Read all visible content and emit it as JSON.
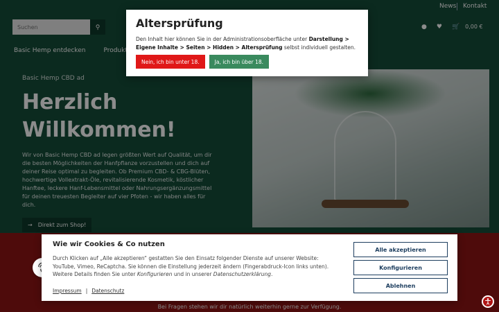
{
  "topbar": {
    "news": "News",
    "kontakt": "Kontakt"
  },
  "header": {
    "search_placeholder": "Suchen",
    "cart_total": "0,00 €"
  },
  "nav": {
    "items": [
      "Basic Hemp entdecken",
      "Produkte"
    ]
  },
  "hero": {
    "subtitle": "Basic Hemp CBD ad",
    "title_line1": "Herzlich",
    "title_line2": "Willkommen!",
    "text": "Wir von Basic Hemp CBD ad legen größten Wert auf Qualität, um dir die besten Möglichkeiten der Hanfpflanze vorzustellen und dich auf deiner Reise optimal zu begleiten. Ob Premium CBD- & CBG-Blüten, hochwertige Vollextrakt-Öle, revitalisierende Kosmetik, köstlicher Hanftee, leckere Hanf-Lebensmittel oder Nahrungsergänzungsmittel für deinen treuesten Begleiter auf vier Pfoten - wir haben alles für dich.",
    "button": "Direkt zum Shop!"
  },
  "band_text": "Bei Fragen stehen wir dir natürlich weiterhin gerne zur Verfügung.",
  "age_modal": {
    "title": "Altersprüfung",
    "text_prefix": "Den Inhalt hier können Sie in der Administrationsoberfläche unter ",
    "text_bold": "Darstellung > Eigene Inhalte > Seiten > Hidden > Altersprüfung",
    "text_suffix": " selbst individuell gestalten.",
    "btn_no": "Nein, ich bin unter 18.",
    "btn_yes": "Ja, ich bin über 18."
  },
  "cookie": {
    "title": "Wie wir Cookies & Co nutzen",
    "text_a": "Durch Klicken auf „Alle akzeptieren“ gestatten Sie den Einsatz folgender Dienste auf unserer Website: YouTube, Vimeo, ReCaptcha. Sie können die Einstellung jederzeit ändern (Fingerabdruck-Icon links unten). Weitere Details finden Sie unter ",
    "text_i1": "Konfigurieren",
    "text_b": " und in unserer ",
    "text_i2": "Datenschutzerklärung",
    "text_c": ".",
    "link_impressum": "Impressum",
    "link_sep": "|",
    "link_datenschutz": "Datenschutz",
    "btn_accept": "Alle akzeptieren",
    "btn_configure": "Konfigurieren",
    "btn_decline": "Ablehnen"
  },
  "colors": {
    "brand_green": "#154d3a",
    "band_red": "#8e1414",
    "no_red": "#e01818",
    "yes_green": "#3a8a5e",
    "button_blue": "#1c3d5e"
  }
}
